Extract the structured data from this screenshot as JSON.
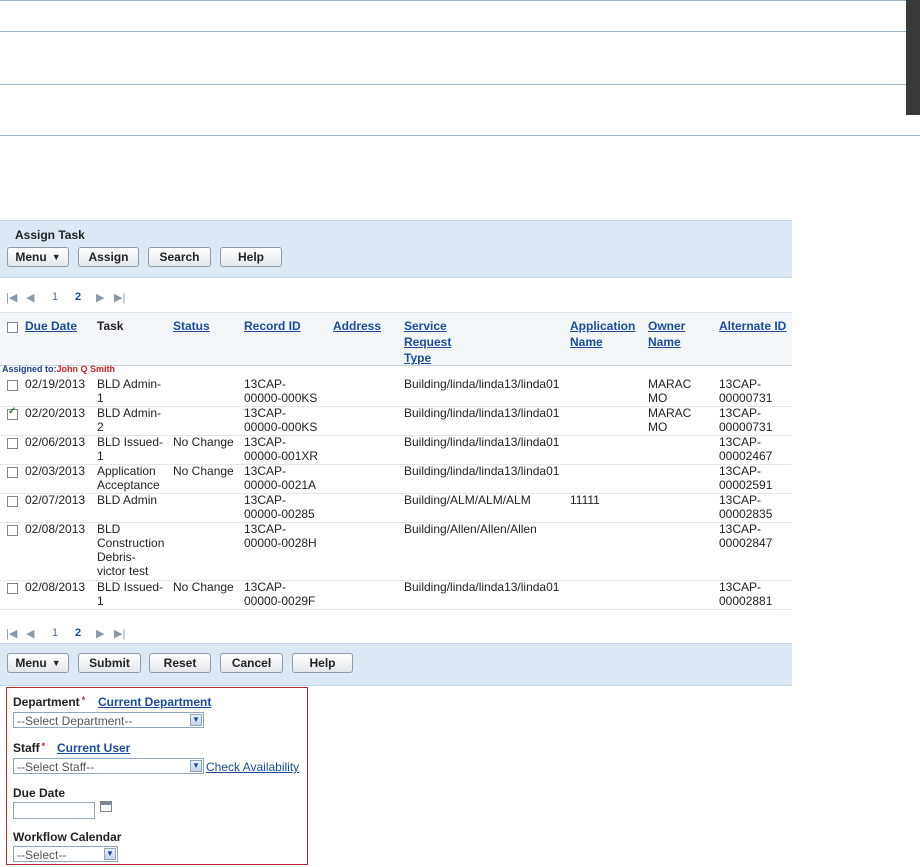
{
  "panel": {
    "title": "Assign Task"
  },
  "toolbar1": {
    "menu": "Menu",
    "assign": "Assign",
    "search": "Search",
    "help": "Help"
  },
  "pager": {
    "page1": "1",
    "page2": "2"
  },
  "columns": {
    "due_date": "Due Date",
    "task": "Task",
    "status": "Status",
    "record_id": "Record ID",
    "address": "Address",
    "srt1": "Service",
    "srt2": "Request",
    "srt3": "Type",
    "app1": "Application",
    "app2": "Name",
    "own1": "Owner",
    "own2": "Name",
    "alternate_id": "Alternate ID"
  },
  "assigned": {
    "label": "Assigned to:",
    "name": "John Q Smith"
  },
  "rows": [
    {
      "checked": false,
      "due": "02/19/2013",
      "task": [
        "BLD Admin-",
        "1"
      ],
      "status": "",
      "record": [
        "13CAP-",
        "00000-000KS"
      ],
      "type": "Building/linda/linda13/linda01",
      "app": "",
      "owner": [
        "MARAC",
        "MO"
      ],
      "alt": [
        "13CAP-",
        "00000731"
      ]
    },
    {
      "checked": true,
      "due": "02/20/2013",
      "task": [
        "BLD Admin-",
        "2"
      ],
      "status": "",
      "record": [
        "13CAP-",
        "00000-000KS"
      ],
      "type": "Building/linda/linda13/linda01",
      "app": "",
      "owner": [
        "MARAC",
        "MO"
      ],
      "alt": [
        "13CAP-",
        "00000731"
      ]
    },
    {
      "checked": false,
      "due": "02/06/2013",
      "task": [
        "BLD Issued-",
        "1"
      ],
      "status": "No Change",
      "record": [
        "13CAP-",
        "00000-001XR"
      ],
      "type": "Building/linda/linda13/linda01",
      "app": "",
      "owner": [
        "",
        ""
      ],
      "alt": [
        "13CAP-",
        "00002467"
      ]
    },
    {
      "checked": false,
      "due": "02/03/2013",
      "task": [
        "Application",
        "Acceptance"
      ],
      "status": "No Change",
      "record": [
        "13CAP-",
        "00000-0021A"
      ],
      "type": "Building/linda/linda13/linda01",
      "app": "",
      "owner": [
        "",
        ""
      ],
      "alt": [
        "13CAP-",
        "00002591"
      ]
    },
    {
      "checked": false,
      "due": "02/07/2013",
      "task": [
        "BLD Admin"
      ],
      "status": "",
      "record": [
        "13CAP-",
        "00000-00285"
      ],
      "type": "Building/ALM/ALM/ALM",
      "app": "11111",
      "owner": [
        "",
        ""
      ],
      "alt": [
        "13CAP-",
        "00002835"
      ]
    },
    {
      "checked": false,
      "due": "02/08/2013",
      "task": [
        "BLD",
        "Construction",
        "Debris-",
        "victor test"
      ],
      "status": "",
      "record": [
        "13CAP-",
        "00000-0028H"
      ],
      "type": "Building/Allen/Allen/Allen",
      "app": "",
      "owner": [
        "",
        ""
      ],
      "alt": [
        "13CAP-",
        "00002847"
      ]
    },
    {
      "checked": false,
      "due": "02/08/2013",
      "task": [
        "BLD Issued-",
        "1"
      ],
      "status": "No Change",
      "record": [
        "13CAP-",
        "00000-0029F"
      ],
      "type": "Building/linda/linda13/linda01",
      "app": "",
      "owner": [
        "",
        ""
      ],
      "alt": [
        "13CAP-",
        "00002881"
      ]
    }
  ],
  "toolbar2": {
    "menu": "Menu",
    "submit": "Submit",
    "reset": "Reset",
    "cancel": "Cancel",
    "help": "Help"
  },
  "form": {
    "department_label": "Department",
    "current_department": "Current Department",
    "department_value": "--Select Department--",
    "staff_label": "Staff",
    "current_user": "Current User",
    "staff_value": "--Select Staff--",
    "check_availability": "Check Availability",
    "due_date_label": "Due Date",
    "workflow_label": "Workflow Calendar",
    "workflow_value": "--Select--"
  },
  "icons": {
    "menu_arrow": "menu-dropdown-icon",
    "select_arrow": "chevron-down-icon",
    "calendar": "calendar-icon",
    "pager_first": "first-page-icon",
    "pager_prev": "prev-page-icon",
    "pager_next": "next-page-icon",
    "pager_last": "last-page-icon"
  },
  "colors": {
    "link": "#1a4c9a",
    "required": "#d42020",
    "panel_bg": "#dce9f5",
    "form_border": "#b52a2a"
  }
}
